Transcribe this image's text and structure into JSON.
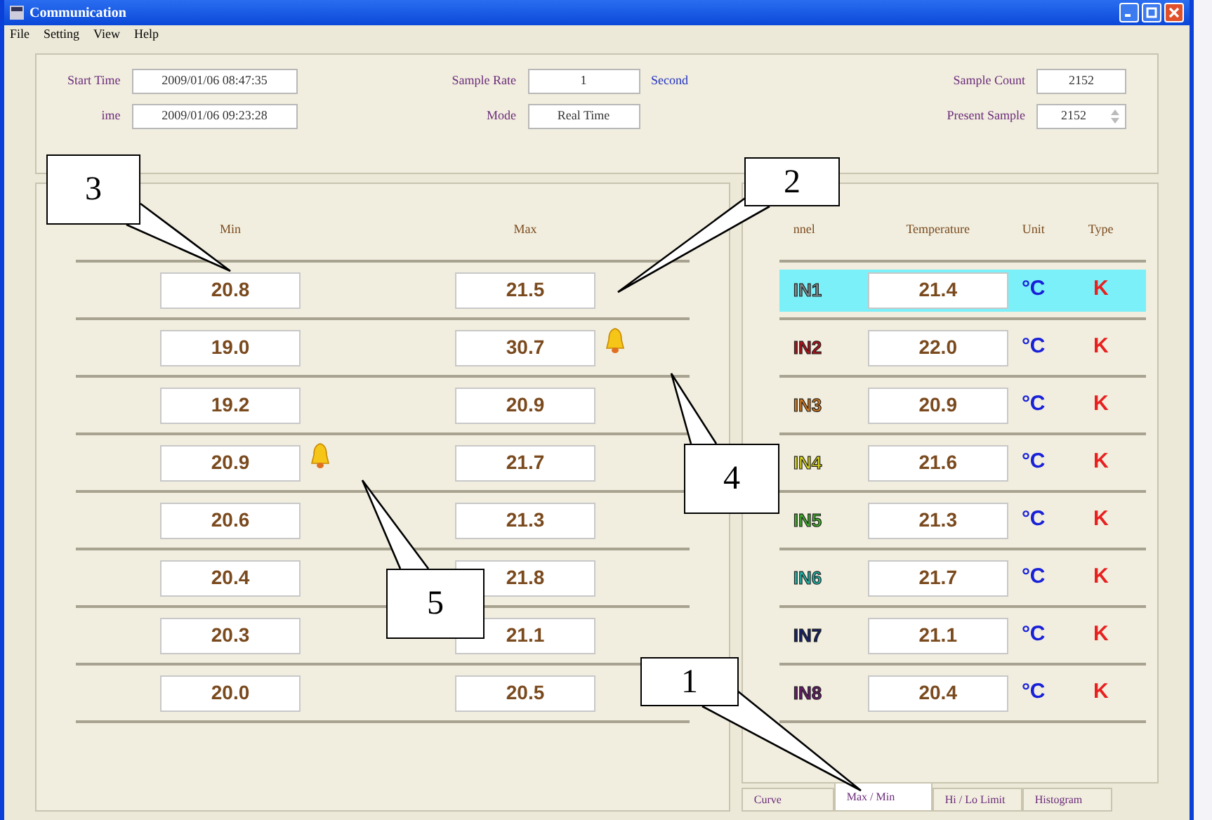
{
  "window": {
    "title": "Communication"
  },
  "menu": [
    "File",
    "Setting",
    "View",
    "Help"
  ],
  "info": {
    "start_time": {
      "label": "Start Time",
      "value": "2009/01/06 08:47:35"
    },
    "stop_time": {
      "label": "ime",
      "value": "2009/01/06 09:23:28"
    },
    "sample_rate": {
      "label": "Sample Rate",
      "value": "1",
      "unit": "Second"
    },
    "mode": {
      "label": "Mode",
      "value": "Real Time"
    },
    "sample_count": {
      "label": "Sample Count",
      "value": "2152"
    },
    "present_sample": {
      "label": "Present Sample",
      "value": "2152"
    }
  },
  "minmax": {
    "columns": [
      "Min",
      "Max"
    ],
    "rows": [
      {
        "min": "20.8",
        "min_alarm": false,
        "max": "21.5",
        "max_alarm": false
      },
      {
        "min": "19.0",
        "min_alarm": false,
        "max": "30.7",
        "max_alarm": true
      },
      {
        "min": "19.2",
        "min_alarm": false,
        "max": "20.9",
        "max_alarm": false
      },
      {
        "min": "20.9",
        "min_alarm": true,
        "max": "21.7",
        "max_alarm": false
      },
      {
        "min": "20.6",
        "min_alarm": false,
        "max": "21.3",
        "max_alarm": false
      },
      {
        "min": "20.4",
        "min_alarm": false,
        "max": "21.8",
        "max_alarm": false
      },
      {
        "min": "20.3",
        "min_alarm": false,
        "max": "21.1",
        "max_alarm": false
      },
      {
        "min": "20.0",
        "min_alarm": false,
        "max": "20.5",
        "max_alarm": false
      }
    ]
  },
  "channels": {
    "columns": [
      "nnel",
      "Temperature",
      "Unit",
      "Type"
    ],
    "rows": [
      {
        "name": "IN1",
        "color": "#7f8c8d",
        "value": "21.4",
        "unit": "°C",
        "type": "K",
        "selected": true
      },
      {
        "name": "IN2",
        "color": "#b0121b",
        "value": "22.0",
        "unit": "°C",
        "type": "K",
        "selected": false
      },
      {
        "name": "IN3",
        "color": "#d2781e",
        "value": "20.9",
        "unit": "°C",
        "type": "K",
        "selected": false
      },
      {
        "name": "IN4",
        "color": "#d6d21c",
        "value": "21.6",
        "unit": "°C",
        "type": "K",
        "selected": false
      },
      {
        "name": "IN5",
        "color": "#3fae2a",
        "value": "21.3",
        "unit": "°C",
        "type": "K",
        "selected": false
      },
      {
        "name": "IN6",
        "color": "#1fb5a8",
        "value": "21.7",
        "unit": "°C",
        "type": "K",
        "selected": false
      },
      {
        "name": "IN7",
        "color": "#14206b",
        "value": "21.1",
        "unit": "°C",
        "type": "K",
        "selected": false
      },
      {
        "name": "IN8",
        "color": "#6a1a6e",
        "value": "20.4",
        "unit": "°C",
        "type": "K",
        "selected": false
      }
    ]
  },
  "tabs": [
    {
      "label": "Curve",
      "selected": false
    },
    {
      "label": "Max / Min",
      "selected": true
    },
    {
      "label": "Hi / Lo Limit",
      "selected": false
    },
    {
      "label": "Histogram",
      "selected": false
    }
  ],
  "callouts": [
    "1",
    "2",
    "3",
    "4",
    "5"
  ]
}
